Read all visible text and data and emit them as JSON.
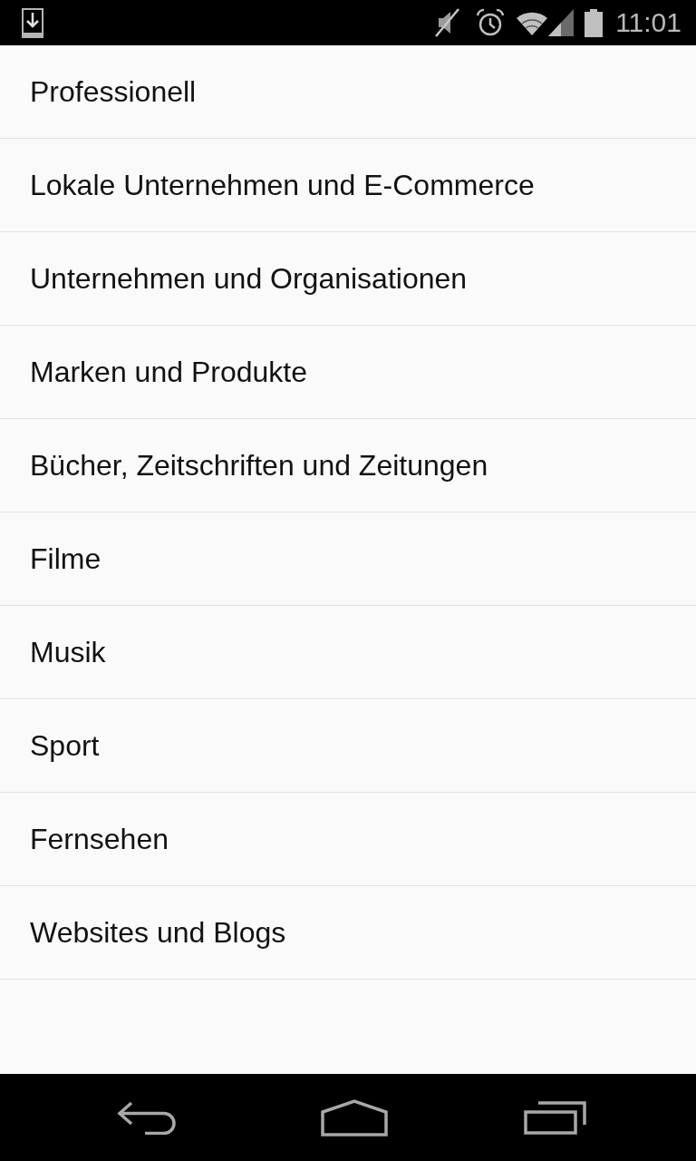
{
  "status_bar": {
    "time": "11:01"
  },
  "categories": [
    {
      "label": "Professionell"
    },
    {
      "label": "Lokale Unternehmen und E-Commerce"
    },
    {
      "label": "Unternehmen und Organisationen"
    },
    {
      "label": "Marken und Produkte"
    },
    {
      "label": "Bücher, Zeitschriften und Zeitungen"
    },
    {
      "label": "Filme"
    },
    {
      "label": "Musik"
    },
    {
      "label": "Sport"
    },
    {
      "label": "Fernsehen"
    },
    {
      "label": "Websites und Blogs"
    }
  ]
}
